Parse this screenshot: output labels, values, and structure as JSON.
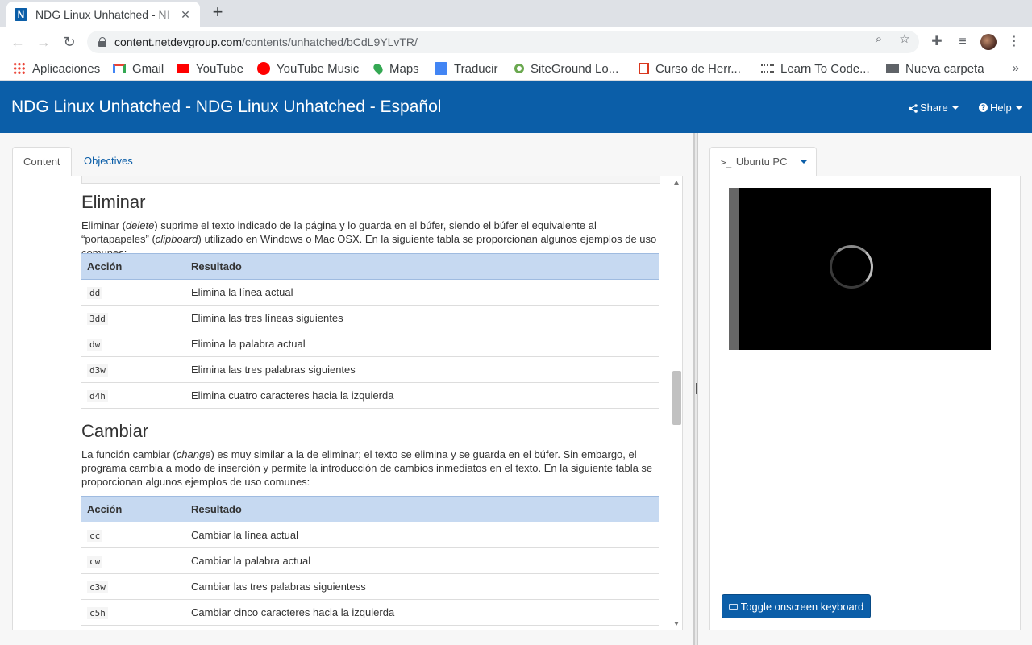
{
  "browser": {
    "tab_title": "NDG Linux Unhatched - NI",
    "favicon_letter": "N",
    "new_tab": "+",
    "close": "✕",
    "url_domain": "content.netdevgroup.com",
    "url_path": "/contents/unhatched/bCdL9YLvTR/",
    "bookmarks": [
      {
        "label": "Aplicaciones",
        "icon": "apps-grid-icon",
        "color": "#ea4335"
      },
      {
        "label": "Gmail",
        "icon": "gmail-icon",
        "color": "#ea4335"
      },
      {
        "label": "YouTube",
        "icon": "youtube-icon",
        "color": "#ff0000"
      },
      {
        "label": "YouTube Music",
        "icon": "youtube-music-icon",
        "color": "#ff0000"
      },
      {
        "label": "Maps",
        "icon": "maps-pin-icon",
        "color": "#34a853"
      },
      {
        "label": "Traducir",
        "icon": "translate-icon",
        "color": "#4285f4"
      },
      {
        "label": "SiteGround Lo...",
        "icon": "siteground-icon",
        "color": "#6aa84f"
      },
      {
        "label": "Curso de Herr...",
        "icon": "course-icon",
        "color": "#d9381e"
      },
      {
        "label": "Learn To Code...",
        "icon": "cisco-icon",
        "color": "#555555"
      },
      {
        "label": "Nueva carpeta",
        "icon": "folder-icon",
        "color": "#5f6368"
      }
    ],
    "bookmarks_more": "»"
  },
  "header": {
    "title": "NDG Linux Unhatched - NDG Linux Unhatched - Español",
    "share": "Share",
    "help": "Help",
    "bg_color": "#0b5ea8"
  },
  "content_tabs": [
    "Content",
    "Objectives"
  ],
  "sections": {
    "eliminar": {
      "title": "Eliminar",
      "intro_a": "Eliminar (",
      "intro_em1": "delete",
      "intro_b": ") suprime el texto indicado de la página y lo guarda en el búfer, siendo el búfer el equivalente al “portapapeles” (",
      "intro_em2": "clipboard",
      "intro_c": ") utilizado en Windows o Mac OSX. En la siguiente tabla se proporcionan algunos ejemplos de uso comunes:",
      "col_action": "Acción",
      "col_result": "Resultado",
      "rows": [
        {
          "cmd": "dd",
          "result": "Elimina la línea actual"
        },
        {
          "cmd": "3dd",
          "result": "Elimina las tres líneas siguientes"
        },
        {
          "cmd": "dw",
          "result": "Elimina la palabra actual"
        },
        {
          "cmd": "d3w",
          "result": "Elimina las tres palabras siguientes"
        },
        {
          "cmd": "d4h",
          "result": "Elimina cuatro caracteres hacia la izquierda"
        }
      ]
    },
    "cambiar": {
      "title": "Cambiar",
      "intro_a": "La función cambiar (",
      "intro_em1": "change",
      "intro_b": ") es muy similar a la de eliminar; el texto se elimina y se guarda en el búfer. Sin embargo, el programa cambia a modo de inserción y permite la introducción de cambios inmediatos en el texto. En la siguiente tabla se proporcionan algunos ejemplos de uso comunes:",
      "col_action": "Acción",
      "col_result": "Resultado",
      "rows": [
        {
          "cmd": "cc",
          "result": "Cambiar la línea actual"
        },
        {
          "cmd": "cw",
          "result": "Cambiar la palabra actual"
        },
        {
          "cmd": "c3w",
          "result": "Cambiar las tres palabras siguientess"
        },
        {
          "cmd": "c5h",
          "result": "Cambiar cinco caracteres hacia la izquierda"
        }
      ]
    }
  },
  "vm": {
    "tab_prefix": ">_",
    "tab_label": "Ubuntu PC",
    "keyboard_button": "Toggle onscreen keyboard"
  }
}
